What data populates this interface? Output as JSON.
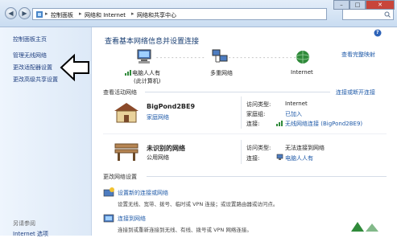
{
  "window": {
    "min": "–",
    "max": "□",
    "close": "✕"
  },
  "address": {
    "back": "◀",
    "fwd": "▶",
    "root_sep": "▸",
    "crumbs": [
      "控制面板",
      "网络和 Internet",
      "网络和共享中心"
    ]
  },
  "help": "?",
  "sidebar": {
    "items": [
      "控制面板主页",
      "管理无线网络",
      "更改适配器设置",
      "更改高级共享设置"
    ],
    "see_also": "另请参阅",
    "bottom_link": "Internet 选项"
  },
  "main": {
    "title": "查看基本网络信息并设置连接",
    "view_full_map": "查看完整映射",
    "map": {
      "node1": "电脑人人有",
      "node1_sub": "(此计算机)",
      "node2": "多重网络",
      "node3": "Internet"
    },
    "active_header": "查看活动网络",
    "connect_disconnect": "连接或断开连接",
    "net1": {
      "name": "BigPond2BE9",
      "type": "家庭网络",
      "access_label": "访问类型:",
      "access_value": "Internet",
      "group_label": "家庭组:",
      "group_value": "已加入",
      "conn_label": "连接:",
      "conn_value": "无线网络连接 (BigPond2BE9)"
    },
    "net2": {
      "name": "未识别的网络",
      "type": "公用网络",
      "access_label": "访问类型:",
      "access_value": "无法连接到网络",
      "conn_label": "连接:",
      "conn_value": "电脑人人有"
    },
    "change_header": "更改网络设置",
    "tasks": [
      {
        "title": "设置新的连接或网络",
        "desc": "设置无线、宽带、拨号、临时或 VPN 连接；或设置路由器或访问点。"
      },
      {
        "title": "连接到网络",
        "desc": "连接到或重新连接到无线、有线、拨号或 VPN 网络连接。"
      }
    ]
  }
}
